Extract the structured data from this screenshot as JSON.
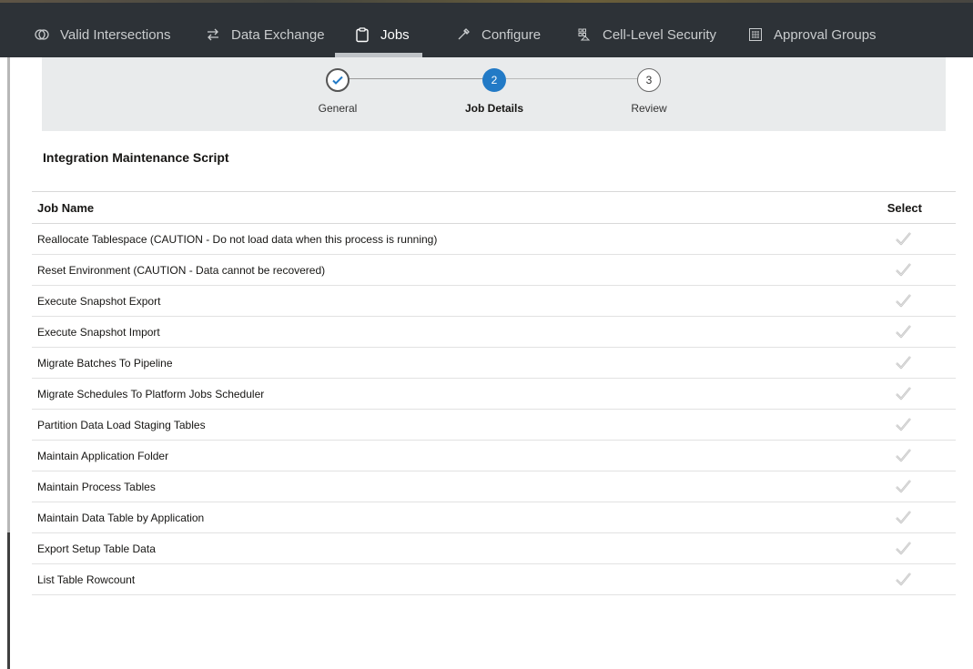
{
  "nav": {
    "items": [
      {
        "label": "Valid Intersections",
        "icon": "valid-intersections-icon"
      },
      {
        "label": "Data Exchange",
        "icon": "data-exchange-icon"
      },
      {
        "label": "Jobs",
        "icon": "jobs-icon",
        "active": true
      },
      {
        "label": "Configure",
        "icon": "configure-icon"
      },
      {
        "label": "Cell-Level Security",
        "icon": "cell-level-security-icon"
      },
      {
        "label": "Approval Groups",
        "icon": "approval-groups-icon"
      }
    ]
  },
  "train": {
    "steps": [
      {
        "label": "General",
        "state": "done",
        "number": "1"
      },
      {
        "label": "Job Details",
        "state": "current",
        "number": "2"
      },
      {
        "label": "Review",
        "state": "future",
        "number": "3"
      }
    ]
  },
  "section": {
    "title": "Integration Maintenance Script"
  },
  "table": {
    "headers": {
      "name": "Job Name",
      "select": "Select"
    },
    "rows": [
      "Reallocate Tablespace (CAUTION - Do not load data when this process is running)",
      "Reset Environment (CAUTION - Data cannot be recovered)",
      "Execute Snapshot Export",
      "Execute Snapshot Import",
      "Migrate Batches To Pipeline",
      "Migrate Schedules To Platform Jobs Scheduler",
      "Partition Data Load Staging Tables",
      "Maintain Application Folder",
      "Maintain Process Tables",
      "Maintain Data Table by Application",
      "Export Setup Table Data",
      "List Table Rowcount"
    ]
  },
  "colors": {
    "nav_bg": "#2d3237",
    "accent": "#227ac6",
    "train_bg": "#e9ebec"
  }
}
